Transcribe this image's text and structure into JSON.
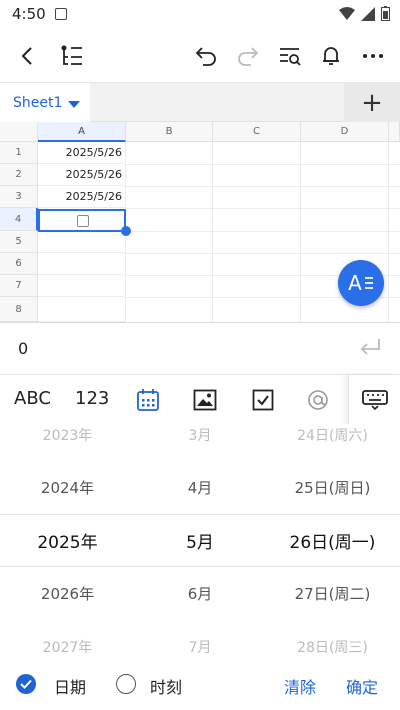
{
  "status_bar": {
    "time": "4:50"
  },
  "sheet_tabs": {
    "active": "Sheet1",
    "add_label": "+"
  },
  "grid": {
    "columns": [
      "A",
      "B",
      "C",
      "D"
    ],
    "rows": [
      "1",
      "2",
      "3",
      "4",
      "5",
      "6",
      "7",
      "8"
    ],
    "cells": [
      {
        "ref": "A1",
        "value": "2025/5/26"
      },
      {
        "ref": "A2",
        "value": "2025/5/26"
      },
      {
        "ref": "A3",
        "value": "2025/5/26"
      }
    ],
    "fab_label": "A"
  },
  "formula": {
    "value": "0"
  },
  "input_types": {
    "text": "ABC",
    "number": "123"
  },
  "picker": {
    "years": [
      "2023年",
      "2024年",
      "2025年",
      "2026年",
      "2027年"
    ],
    "months": [
      "3月",
      "4月",
      "5月",
      "6月",
      "7月"
    ],
    "days": [
      "24日(周六)",
      "25日(周日)",
      "26日(周一)",
      "27日(周二)",
      "28日(周三)"
    ]
  },
  "bottom_bar": {
    "date_label": "日期",
    "time_label": "时刻",
    "clear_label": "清除",
    "confirm_label": "确定"
  },
  "colors": {
    "accent": "#1e64d8"
  }
}
